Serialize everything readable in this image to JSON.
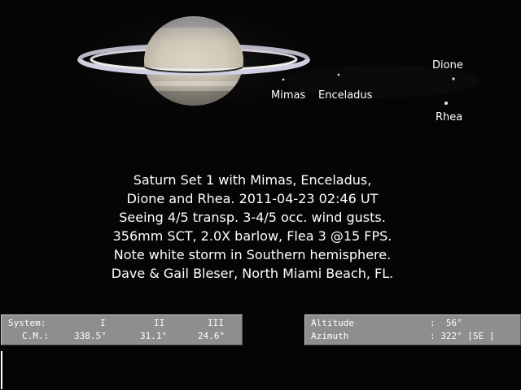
{
  "moons": {
    "mimas": "Mimas",
    "enceladus": "Enceladus",
    "dione": "Dione",
    "rhea": "Rhea"
  },
  "caption_lines": [
    "Saturn Set 1  with Mimas, Enceladus,",
    "Dione and Rhea. 2011-04-23 02:46 UT",
    "Seeing 4/5 transp. 3-4/5 occ. wind gusts.",
    "356mm SCT, 2.0X barlow, Flea 3 @15 FPS.",
    "Note white storm in Southern hemisphere.",
    "Dave & Gail Bleser, North Miami Beach, FL."
  ],
  "system_panel": {
    "label_system": "System:",
    "label_cm": "C.M.:",
    "col_i": "I",
    "col_ii": "II",
    "col_iii": "III",
    "val_i": "338.5°",
    "val_ii": "31.1°",
    "val_iii": "24.6°"
  },
  "position_panel": {
    "altitude_label": "Altitude",
    "altitude_value": ":  56°",
    "azimuth_label": "Azimuth",
    "azimuth_value": ": 322° [SE ]"
  },
  "colors": {
    "background": "#050505",
    "panel": "#8e8e8e",
    "text": "#ffffff"
  }
}
